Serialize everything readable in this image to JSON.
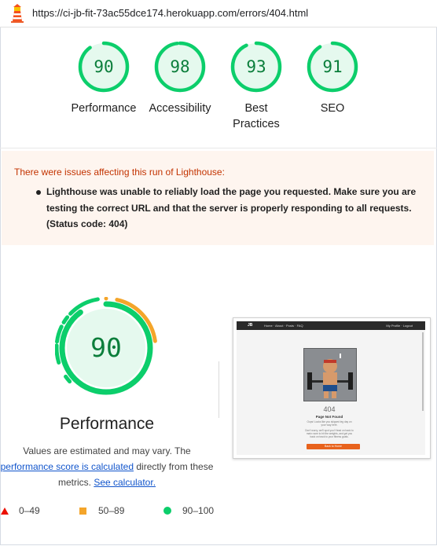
{
  "url_bar": {
    "url": "https://ci-jb-fit-73ac55dce174.herokuapp.com/errors/404.html",
    "icon": "lighthouse-icon"
  },
  "colors": {
    "pass": "#0cce6b",
    "pass_text": "#0b7e3b",
    "average": "#f4a52a",
    "fail": "#eb0f00",
    "warning_text": "#c33300",
    "warning_bg": "#fef5ef",
    "link": "#1155cc"
  },
  "gauges": [
    {
      "score": "90",
      "label": "Performance"
    },
    {
      "score": "98",
      "label": "Accessibility"
    },
    {
      "score": "93",
      "label": "Best Practices"
    },
    {
      "score": "91",
      "label": "SEO"
    }
  ],
  "warning": {
    "title": "There were issues affecting this run of Lighthouse:",
    "items": [
      "Lighthouse was unable to reliably load the page you requested. Make sure you are testing the correct URL and that the server is properly responding to all requests. (Status code: 404)"
    ]
  },
  "performance": {
    "score": "90",
    "title": "Performance",
    "desc_prefix": "Values are estimated and may vary. The",
    "desc_link": "performance score is calculated",
    "desc_mid": "directly from these metrics.",
    "desc_link2": "See calculator."
  },
  "legend": [
    {
      "range": "0–49",
      "icon": "triangle-fail-icon"
    },
    {
      "range": "50–89",
      "icon": "square-average-icon"
    },
    {
      "range": "90–100",
      "icon": "circle-pass-icon"
    }
  ],
  "screenshot": {
    "brand": "JB",
    "nav_links": "Home · About · Posts · FAQ",
    "nav_right": "My Profile · Logout",
    "heading": "404",
    "subheading": "Page Not Found",
    "text1": "Oops! Looks like you skipped leg day on your way here.",
    "text2": "Don't worry, we'll spot you! Head on back to main room to hit the weights, and get you back on track to your fitness goals.",
    "button": "Back to Home"
  }
}
